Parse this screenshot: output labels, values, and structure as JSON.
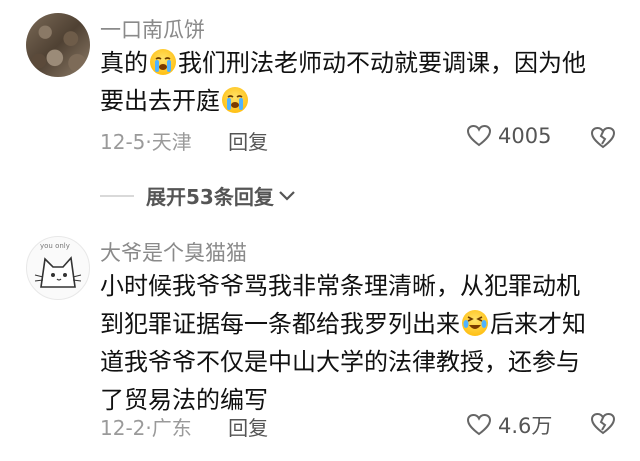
{
  "comments": [
    {
      "username": "一口南瓜饼",
      "text_a": "真的",
      "text_b": "我们刑法老师动不动就要调课，因为他",
      "text_c": "要出去开庭",
      "date": "12-5",
      "location": "天津",
      "reply_label": "回复",
      "likes": "4005"
    },
    {
      "username": "大爷是个臭猫猫",
      "line1": "小时候我爷爷骂我非常条理清晰，从犯罪动机",
      "line2a": "到犯罪证据每一条都给我罗列出来",
      "line2b": "后来才知",
      "line3": "道我爷爷不仅是中山大学的法律教授，还参与",
      "line4": "了贸易法的编写",
      "date": "12-2",
      "location": "广东",
      "reply_label": "回复",
      "likes": "4.6万",
      "avatar_text": "you only"
    }
  ],
  "expand_replies": "展开53条回复",
  "colors": {
    "username": "#8a8a8a",
    "meta": "#9a9a9a",
    "text": "#111111"
  }
}
